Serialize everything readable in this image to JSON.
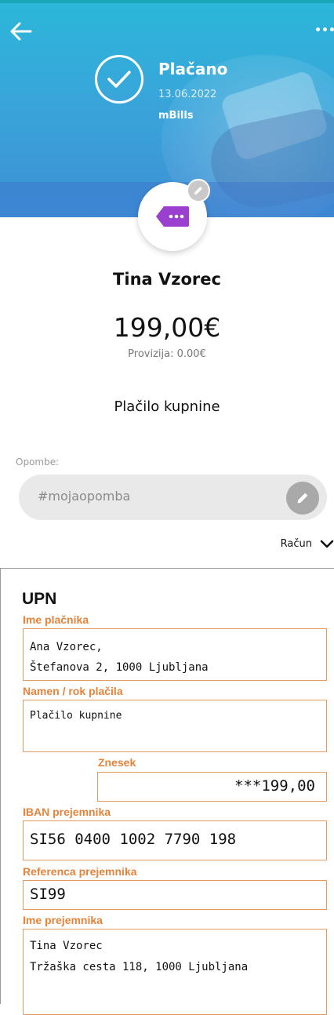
{
  "header": {
    "status": "Plačano",
    "date": "13.06.2022",
    "via": "mBills"
  },
  "icons": {
    "back": "arrow-left-icon",
    "more": "more-dots-icon",
    "status": "check-circle-icon",
    "category": "tag-icon",
    "edit": "pencil-icon",
    "dropdown": "chevron-down-icon"
  },
  "colors": {
    "accent_purple": "#9b3fd1",
    "form_orange": "#e2843c"
  },
  "recipient": {
    "name": "Tina Vzorec"
  },
  "payment": {
    "amount": "199,00€",
    "fee": "Provizija: 0.00€",
    "purpose": "Plačilo kupnine"
  },
  "notes": {
    "label": "Opombe:",
    "placeholder": "#mojaopomba"
  },
  "receipt_toggle": {
    "label": "Račun"
  },
  "upn": {
    "title": "UPN",
    "payer_label": "Ime plačnika",
    "payer_line1": "Ana Vzorec,",
    "payer_line2": "Štefanova 2, 1000 Ljubljana",
    "purpose_label": "Namen / rok plačila",
    "purpose_value": "Plačilo kupnine",
    "amount_label": "Znesek",
    "amount_value": "***199,00",
    "iban_label": "IBAN prejemnika",
    "iban_value": "SI56 0400 1002 7790 198",
    "reference_label": "Referenca prejemnika",
    "reference_value": "SI99",
    "recipient_label": "Ime prejemnika",
    "recipient_line1": "Tina Vzorec",
    "recipient_line2": "Tržaška cesta 118, 1000 Ljubljana"
  }
}
